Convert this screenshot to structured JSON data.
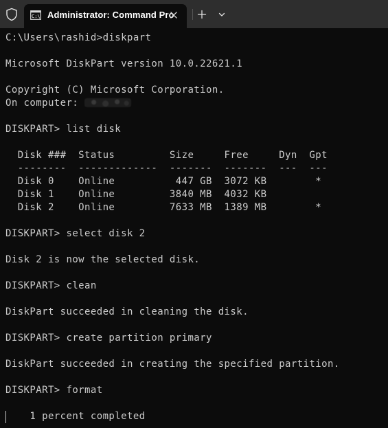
{
  "tab": {
    "title": "Administrator: Command Pro"
  },
  "icons": {
    "shield": "shield-icon",
    "cmd": "command-prompt-icon",
    "close": "close-icon",
    "new_tab": "plus-icon",
    "dropdown": "chevron-down-icon"
  },
  "colors": {
    "titlebar": "#2e2e2e",
    "terminal_bg": "#0c0c0c",
    "terminal_fg": "#cccccc"
  },
  "terminal": {
    "lines": [
      "C:\\Users\\rashid>diskpart",
      "",
      "Microsoft DiskPart version 10.0.22621.1",
      "",
      "Copyright (C) Microsoft Corporation.",
      "On computer: ",
      "",
      "DISKPART> list disk",
      "",
      "  Disk ###  Status         Size     Free     Dyn  Gpt",
      "  --------  -------------  -------  -------  ---  ---",
      "  Disk 0    Online          447 GB  3072 KB        *",
      "  Disk 1    Online         3840 MB  4032 KB",
      "  Disk 2    Online         7633 MB  1389 MB        *",
      "",
      "DISKPART> select disk 2",
      "",
      "Disk 2 is now the selected disk.",
      "",
      "DISKPART> clean",
      "",
      "DiskPart succeeded in cleaning the disk.",
      "",
      "DISKPART> create partition primary",
      "",
      "DiskPart succeeded in creating the specified partition.",
      "",
      "DISKPART> format",
      "",
      "    1 percent completed"
    ]
  }
}
